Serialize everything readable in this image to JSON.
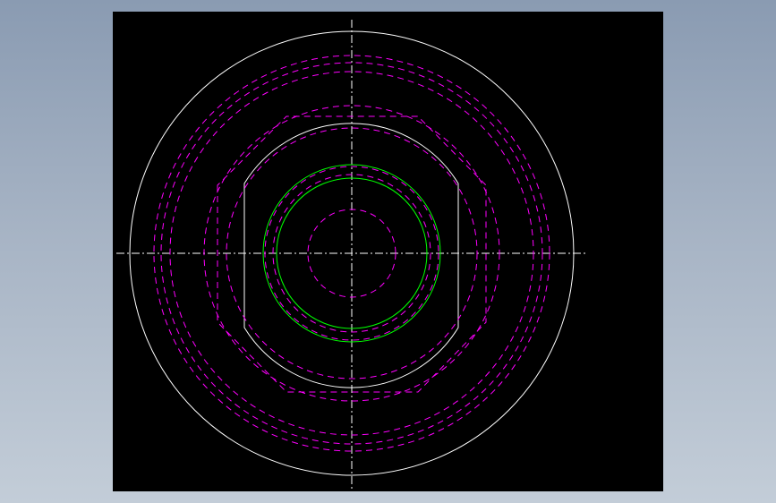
{
  "viewport": {
    "background": "#000000",
    "page_background": "#9aa8bb"
  },
  "drawing": {
    "colors": {
      "outline": "#ffffff",
      "hidden_lines": "#ff00ff",
      "thread_circles": "#00ff00",
      "centerlines": "#ffffff"
    },
    "line_types": {
      "visible": "continuous",
      "hidden": "dashed",
      "center": "dash-dot"
    }
  }
}
